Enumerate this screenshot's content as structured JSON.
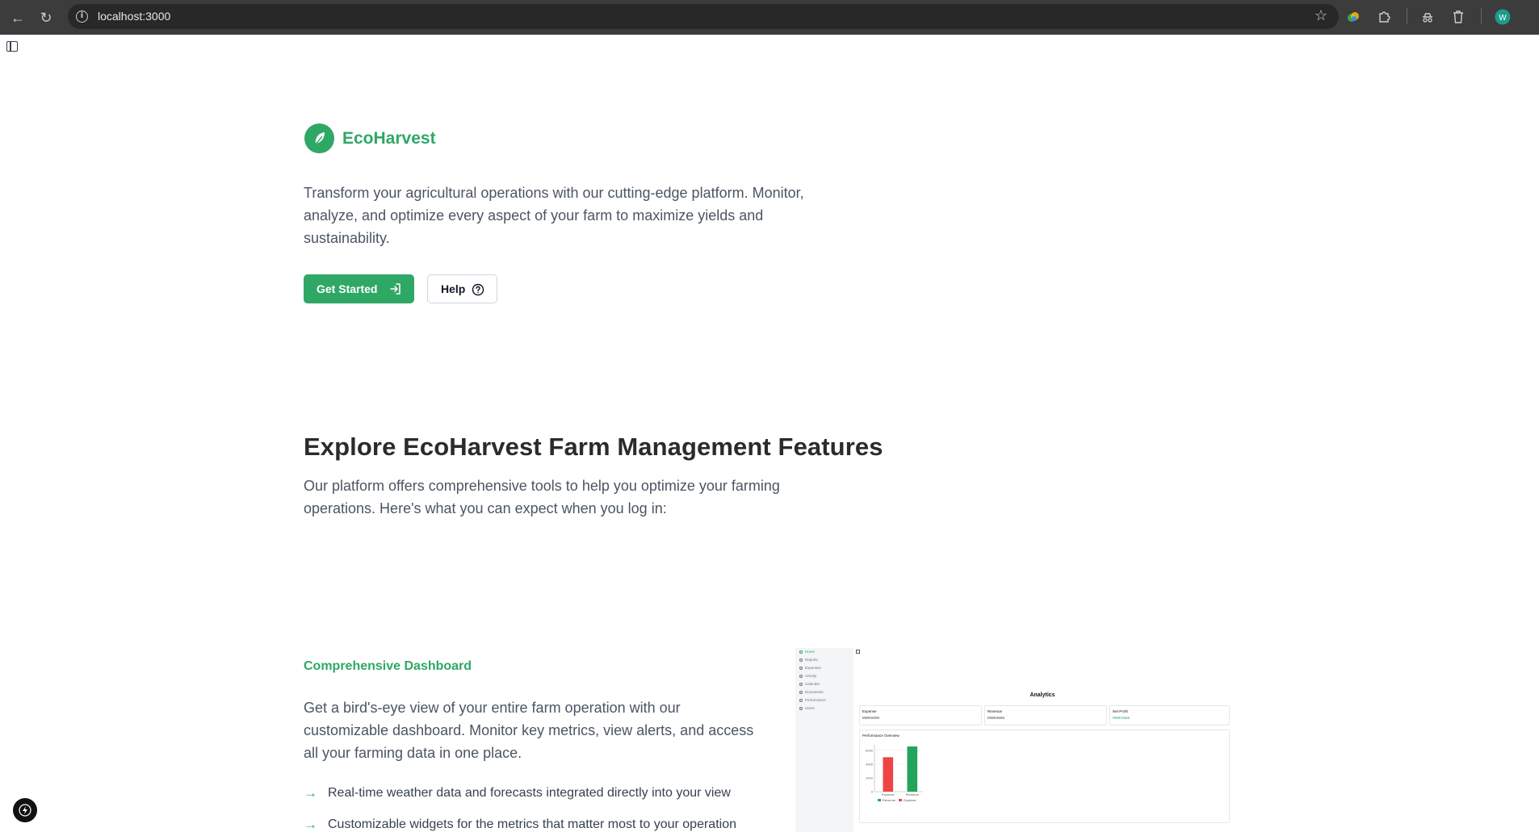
{
  "browser": {
    "url": "localhost:3000"
  },
  "hero": {
    "brand": "EcoHarvest",
    "description": "Transform your agricultural operations with our cutting-edge platform. Monitor, analyze, and optimize every aspect of your farm to maximize yields and sustainability.",
    "primary_button": "Get Started",
    "help_button": "Help"
  },
  "features_section": {
    "title": "Explore EcoHarvest Farm Management Features",
    "description": "Our platform offers comprehensive tools to help you optimize your farming operations. Here's what you can expect when you log in:"
  },
  "feature": {
    "title": "Comprehensive Dashboard",
    "description": "Get a bird's-eye view of your entire farm operation with our customizable dashboard. Monitor key metrics, view alerts, and access all your farming data in one place.",
    "bullets": [
      "Real-time weather data and forecasts integrated directly into your view",
      "Customizable widgets for the metrics that matter most to your operation"
    ]
  },
  "preview": {
    "sidebar_items": [
      "Home",
      "Reports",
      "Expenses",
      "Activity",
      "Calendar",
      "Documents",
      "Performance",
      "Users"
    ],
    "title": "Analytics",
    "stats": [
      {
        "label": "Expense",
        "value": "MWK5000"
      },
      {
        "label": "Revenue",
        "value": "MWK6565"
      },
      {
        "label": "Net Profit",
        "value": "MWK1565"
      }
    ],
    "chart_title": "Performance Overview",
    "chart_data": {
      "type": "bar",
      "categories": [
        "Expense",
        "Revenue"
      ],
      "values": [
        5000,
        6565
      ],
      "ylim": [
        0,
        6800
      ],
      "yticks": [
        0,
        2000,
        4000,
        6000
      ],
      "colors": [
        "#ef4444",
        "#22a55a"
      ],
      "legend": [
        "Revenue",
        "Expense"
      ]
    }
  },
  "colors": {
    "brand": "#2fa865",
    "text_muted": "#4b5563",
    "heading": "#2b2b2b"
  }
}
